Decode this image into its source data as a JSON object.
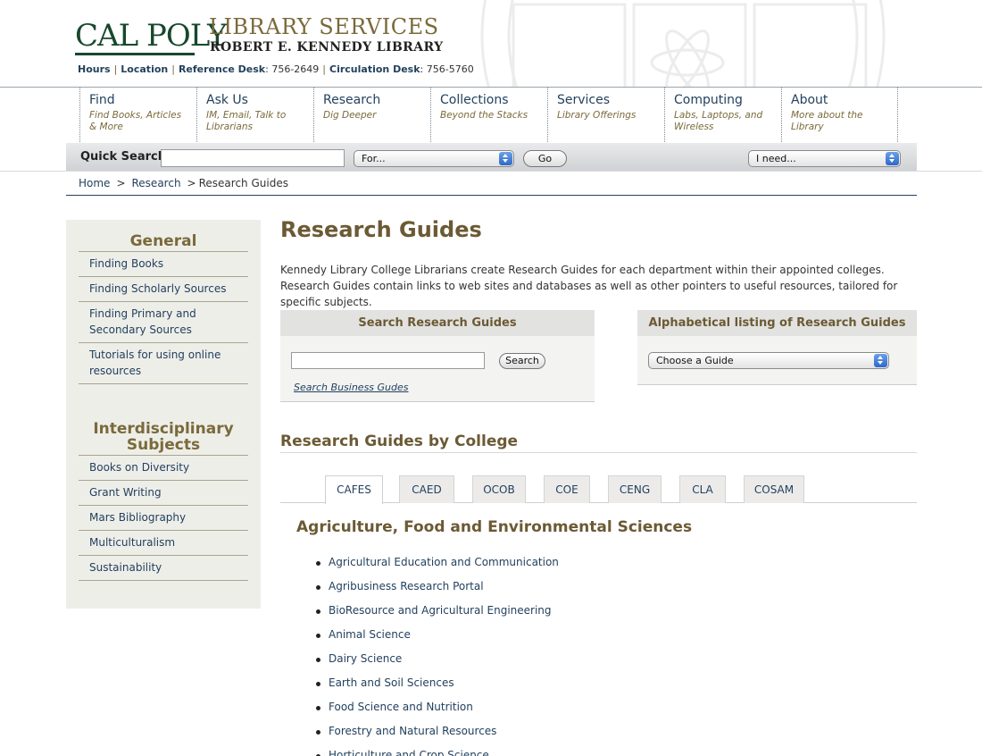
{
  "header": {
    "logo_text": "CAL POLY",
    "library_services": "LIBRARY SERVICES",
    "kennedy_library": "ROBERT E. KENNEDY LIBRARY",
    "links": {
      "hours": "Hours",
      "location": "Location",
      "reference_label": "Reference Desk",
      "reference_phone": ": 756-2649",
      "circulation_label": "Circulation Desk",
      "circulation_phone": ": 756-5760",
      "separator": "|"
    }
  },
  "nav": [
    {
      "title": "Find",
      "sub": "Find Books, Articles & More"
    },
    {
      "title": "Ask Us",
      "sub": "IM, Email, Talk to Librarians"
    },
    {
      "title": "Research",
      "sub": "Dig Deeper"
    },
    {
      "title": "Collections",
      "sub": "Beyond the Stacks"
    },
    {
      "title": "Services",
      "sub": "Library Offerings"
    },
    {
      "title": "Computing",
      "sub": "Labs, Laptops, and Wireless"
    },
    {
      "title": "About",
      "sub": "More about the Library"
    }
  ],
  "quick_search": {
    "label": "Quick Search",
    "input_value": "",
    "for_select": "For...",
    "go_label": "Go",
    "need_select": "I need..."
  },
  "breadcrumb": {
    "home": "Home",
    "research": "Research",
    "current": "Research Guides",
    "sep": ">"
  },
  "sidebar": {
    "general_heading": "General",
    "general_items": [
      "Finding Books",
      "Finding Scholarly Sources",
      "Finding Primary and Secondary Sources",
      "Tutorials for using online resources"
    ],
    "interdisciplinary_heading": "Interdisciplinary Subjects",
    "interdisciplinary_items": [
      "Books on Diversity",
      "Grant Writing",
      "Mars Bibliography",
      "Multiculturalism",
      "Sustainability"
    ]
  },
  "main": {
    "title": "Research Guides",
    "intro": "Kennedy Library College Librarians create Research Guides for each department within their appointed colleges. Research Guides contain links to web sites and databases as well as other pointers to useful resources, tailored for specific subjects.",
    "search_panel": {
      "heading": "Search Research Guides",
      "input_value": "",
      "button": "Search",
      "business_link": "Search Business Gudes"
    },
    "alpha_panel": {
      "heading": "Alphabetical listing of Research Guides",
      "select": "Choose a Guide"
    },
    "college_heading": "Research Guides by College",
    "tabs": [
      "CAFES",
      "CAED",
      "OCOB",
      "COE",
      "CENG",
      "CLA",
      "COSAM"
    ],
    "active_tab": "CAFES",
    "college_name": "Agriculture, Food and Environmental Sciences",
    "guides": [
      "Agricultural Education and Communication",
      "Agribusiness Research Portal",
      "BioResource and Agricultural Engineering",
      "Animal Science",
      "Dairy Science",
      "Earth and Soil Sciences",
      "Food Science and Nutrition",
      "Forestry and Natural Resources",
      "Horticulture and Crop Science"
    ]
  },
  "colors": {
    "brand_green": "#18482d",
    "gold": "#7a6a3a",
    "link_blue": "#23415e"
  }
}
